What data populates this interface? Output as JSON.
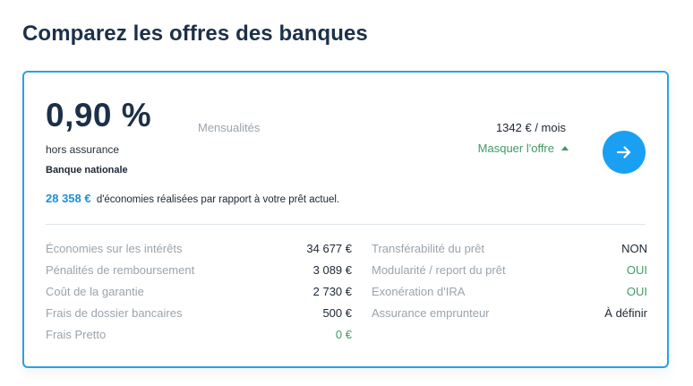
{
  "page": {
    "title": "Comparez les offres des banques"
  },
  "offer": {
    "rate": "0,90 %",
    "rate_note": "hors assurance",
    "bank_name": "Banque nationale",
    "monthly_label": "Mensualités",
    "monthly_value": "1342 € / mois",
    "toggle_label": "Masquer l'offre",
    "savings_amount": "28 358 €",
    "savings_text": "d'économies réalisées par rapport à votre prêt actuel.",
    "details_left": [
      {
        "label": "Économies sur les intérêts",
        "value": "34 677 €"
      },
      {
        "label": "Pénalités de remboursement",
        "value": "3 089 €"
      },
      {
        "label": "Coût de la garantie",
        "value": "2 730 €"
      },
      {
        "label": "Frais de dossier bancaires",
        "value": "500 €"
      },
      {
        "label": "Frais Pretto",
        "value": "0 €"
      }
    ],
    "details_right": [
      {
        "label": "Transférabilité du prêt",
        "value": "NON"
      },
      {
        "label": "Modularité / report du prêt",
        "value": "OUI"
      },
      {
        "label": "Exonération d'IRA",
        "value": "OUI"
      },
      {
        "label": "Assurance emprunteur",
        "value": "À définir"
      }
    ]
  },
  "colors": {
    "accent_blue": "#1aa0f3",
    "border_blue": "#2aa0e8",
    "positive_green": "#3f9a66",
    "title_navy": "#1c3048"
  },
  "icons": {
    "toggle": "caret-up-icon",
    "action": "arrow-right-icon"
  }
}
